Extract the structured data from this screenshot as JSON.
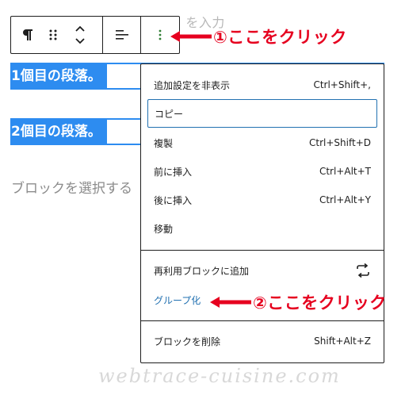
{
  "ghost_text": "ブロックを選択するには「/」を入力",
  "toolbar": {
    "paragraph_icon": "paragraph-icon",
    "drag_icon": "drag-handle-icon",
    "move_icon": "move-up-down-icon",
    "align_icon": "align-left-icon",
    "options_icon": "more-vertical-icon"
  },
  "blocks": [
    {
      "text": "1個目の段落。"
    },
    {
      "text": "2個目の段落。"
    }
  ],
  "placeholder": "ブロックを選択する",
  "menu": {
    "items": [
      {
        "label": "追加設定を非表示",
        "shortcut": "Ctrl+Shift+,"
      },
      {
        "label": "コピー",
        "shortcut": ""
      },
      {
        "label": "複製",
        "shortcut": "Ctrl+Shift+D"
      },
      {
        "label": "前に挿入",
        "shortcut": "Ctrl+Alt+T"
      },
      {
        "label": "後に挿入",
        "shortcut": "Ctrl+Alt+Y"
      },
      {
        "label": "移動",
        "shortcut": ""
      },
      {
        "label": "再利用ブロックに追加",
        "shortcut": ""
      },
      {
        "label": "グループ化",
        "shortcut": ""
      },
      {
        "label": "ブロックを削除",
        "shortcut": "Shift+Alt+Z"
      }
    ]
  },
  "annotations": {
    "step1": "①ここをクリック",
    "step2": "②ここをクリック"
  },
  "colors": {
    "selection_blue": "#2d8cf0",
    "annotation_red": "#e6001f",
    "link_blue": "#2271b1"
  },
  "watermark": "webtrace-cuisine.com"
}
